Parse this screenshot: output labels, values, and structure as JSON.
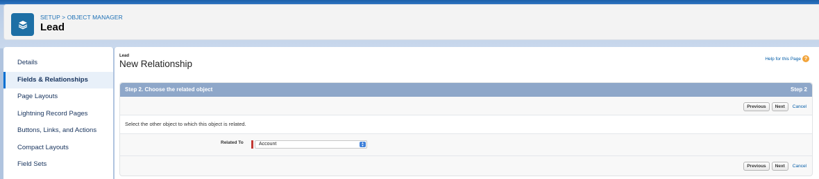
{
  "header": {
    "breadcrumb_setup": "SETUP",
    "breadcrumb_sep": " > ",
    "breadcrumb_object_manager": "OBJECT MANAGER",
    "object_title": "Lead",
    "icon": "layers-icon"
  },
  "sidebar": {
    "items": [
      {
        "label": "Details",
        "active": false
      },
      {
        "label": "Fields & Relationships",
        "active": true
      },
      {
        "label": "Page Layouts",
        "active": false
      },
      {
        "label": "Lightning Record Pages",
        "active": false
      },
      {
        "label": "Buttons, Links, and Actions",
        "active": false
      },
      {
        "label": "Compact Layouts",
        "active": false
      },
      {
        "label": "Field Sets",
        "active": false
      }
    ]
  },
  "main": {
    "page_type": "Lead",
    "page_title": "New Relationship",
    "help_link": "Help for this Page",
    "help_icon": "question-icon",
    "step_title": "Step 2. Choose the related object",
    "step_number": "Step 2",
    "buttons": {
      "previous": "Previous",
      "next": "Next",
      "cancel": "Cancel"
    },
    "instruction": "Select the other object to which this object is related.",
    "field": {
      "label": "Related To",
      "value": "Account"
    }
  },
  "colors": {
    "accent": "#0070d2",
    "step_bar": "#8ea7c9",
    "required": "#c23934",
    "help": "#f2a43a"
  }
}
